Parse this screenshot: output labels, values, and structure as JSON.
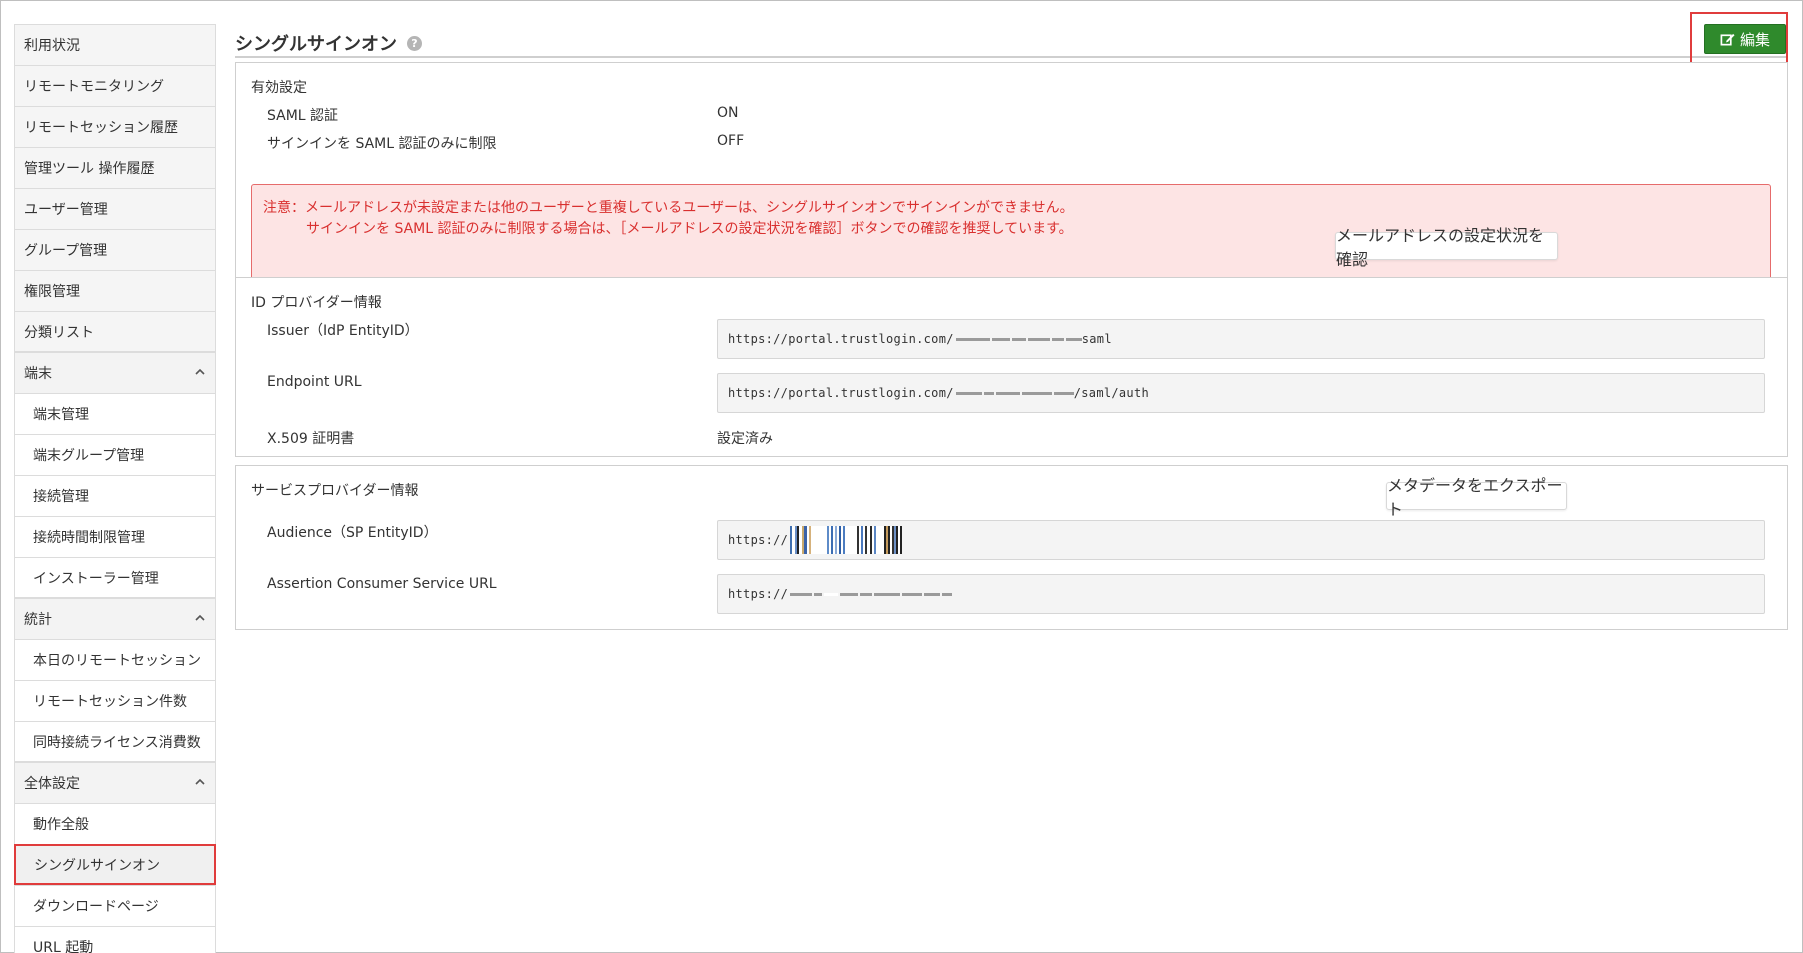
{
  "sidebar": {
    "items": [
      {
        "label": "利用状況",
        "type": "item"
      },
      {
        "label": "リモートモニタリング",
        "type": "item"
      },
      {
        "label": "リモートセッション履歴",
        "type": "item"
      },
      {
        "label": "管理ツール 操作履歴",
        "type": "item"
      },
      {
        "label": "ユーザー管理",
        "type": "item"
      },
      {
        "label": "グループ管理",
        "type": "item"
      },
      {
        "label": "権限管理",
        "type": "item"
      },
      {
        "label": "分類リスト",
        "type": "item"
      },
      {
        "label": "端末",
        "type": "group"
      },
      {
        "label": "端末管理",
        "type": "sub"
      },
      {
        "label": "端末グループ管理",
        "type": "sub"
      },
      {
        "label": "接続管理",
        "type": "sub"
      },
      {
        "label": "接続時間制限管理",
        "type": "sub"
      },
      {
        "label": "インストーラー管理",
        "type": "sub"
      },
      {
        "label": "統計",
        "type": "group"
      },
      {
        "label": "本日のリモートセッション",
        "type": "sub"
      },
      {
        "label": "リモートセッション件数",
        "type": "sub"
      },
      {
        "label": "同時接続ライセンス消費数",
        "type": "sub"
      },
      {
        "label": "全体設定",
        "type": "group"
      },
      {
        "label": "動作全般",
        "type": "sub"
      },
      {
        "label": "シングルサインオン",
        "type": "sub",
        "active": true
      },
      {
        "label": "ダウンロードページ",
        "type": "sub"
      },
      {
        "label": "URL 起動",
        "type": "sub"
      }
    ]
  },
  "header": {
    "title": "シングルサインオン",
    "help_icon": "question-circle-icon",
    "edit_label": "編集",
    "edit_icon": "edit-square-icon"
  },
  "enable_settings": {
    "title": "有効設定",
    "rows": [
      {
        "label": "SAML 認証",
        "value": "ON"
      },
      {
        "label": "サインインを SAML 認証のみに制限",
        "value": "OFF"
      }
    ],
    "warning_line1": "注意：メールアドレスが未設定または他のユーザーと重複しているユーザーは、シングルサインオンでサインインができません。",
    "warning_line2": "サインインを SAML 認証のみに制限する場合は、［メールアドレスの設定状況を確認］ボタンでの確認を推奨しています。",
    "check_button": "メールアドレスの設定状況を確認"
  },
  "idp": {
    "title": "ID プロバイダー情報",
    "issuer_label": "Issuer（IdP EntityID）",
    "issuer_value_prefix": "https://portal.trustlogin.com/",
    "issuer_value_suffix": "saml",
    "endpoint_label": "Endpoint URL",
    "endpoint_value_prefix": "https://portal.trustlogin.com/",
    "endpoint_value_suffix": "/saml/auth",
    "cert_label": "X.509 証明書",
    "cert_value": "設定済み"
  },
  "sp": {
    "title": "サービスプロバイダー情報",
    "export_button": "メタデータをエクスポート",
    "audience_label": "Audience（SP EntityID）",
    "audience_value_prefix": "https://",
    "acs_label": "Assertion Consumer Service URL",
    "acs_value_prefix": "https://"
  },
  "colors": {
    "accent_green": "#2f8a2c",
    "highlight_red": "#e03c3c",
    "warning_bg": "#fde4e4",
    "warning_text": "#d9302f"
  }
}
